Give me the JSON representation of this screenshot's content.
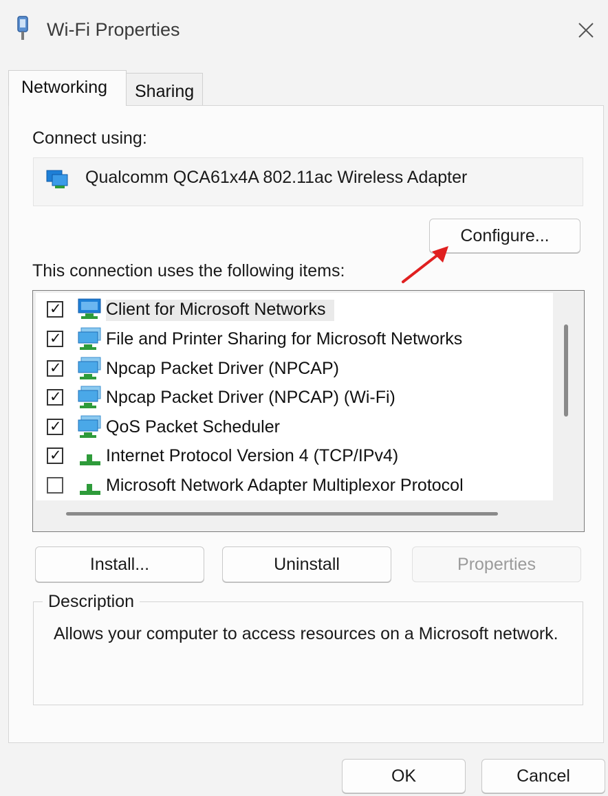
{
  "window": {
    "title": "Wi-Fi Properties",
    "close_icon": "close-icon"
  },
  "tabs": [
    {
      "label": "Networking",
      "active": true
    },
    {
      "label": "Sharing",
      "active": false
    }
  ],
  "connect_using": {
    "label": "Connect using:",
    "adapter": "Qualcomm QCA61x4A 802.11ac Wireless Adapter",
    "configure_button": "Configure..."
  },
  "items_section": {
    "label": "This connection uses the following items:",
    "items": [
      {
        "label": "Client for Microsoft Networks",
        "checked": true,
        "icon": "network-client-icon",
        "selected": true
      },
      {
        "label": "File and Printer Sharing for Microsoft Networks",
        "checked": true,
        "icon": "network-service-icon",
        "selected": false
      },
      {
        "label": "Npcap Packet Driver (NPCAP)",
        "checked": true,
        "icon": "network-service-icon",
        "selected": false
      },
      {
        "label": "Npcap Packet Driver (NPCAP) (Wi-Fi)",
        "checked": true,
        "icon": "network-service-icon",
        "selected": false
      },
      {
        "label": "QoS Packet Scheduler",
        "checked": true,
        "icon": "network-service-icon",
        "selected": false
      },
      {
        "label": "Internet Protocol Version 4 (TCP/IPv4)",
        "checked": true,
        "icon": "protocol-icon",
        "selected": false
      },
      {
        "label": "Microsoft Network Adapter Multiplexor Protocol",
        "checked": false,
        "icon": "protocol-icon",
        "selected": false
      }
    ]
  },
  "actions": {
    "install": "Install...",
    "uninstall": "Uninstall",
    "properties": "Properties"
  },
  "description": {
    "legend": "Description",
    "text": "Allows your computer to access resources on a Microsoft network."
  },
  "footer": {
    "ok": "OK",
    "cancel": "Cancel"
  },
  "colors": {
    "annotation_arrow": "#e02020",
    "network_blue": "#1e7fd6",
    "protocol_green": "#2e9b3a"
  }
}
